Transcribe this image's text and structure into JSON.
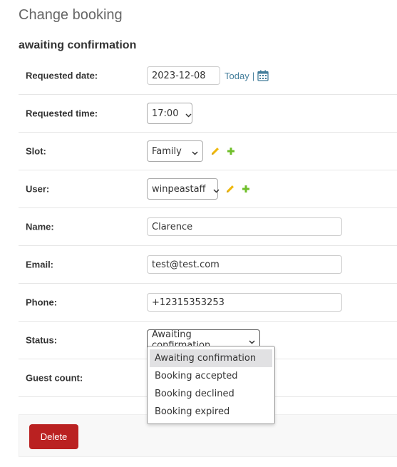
{
  "header": {
    "title": "Change booking",
    "section": "awaiting confirmation"
  },
  "form": {
    "requested_date": {
      "label": "Requested date:",
      "value": "2023-12-08",
      "today_link": "Today",
      "separator": "|"
    },
    "requested_time": {
      "label": "Requested time:",
      "value": "17:00"
    },
    "slot": {
      "label": "Slot:",
      "value": "Family"
    },
    "user": {
      "label": "User:",
      "value": "winpeastaff"
    },
    "name": {
      "label": "Name:",
      "value": "Clarence"
    },
    "email": {
      "label": "Email:",
      "value": "test@test.com"
    },
    "phone": {
      "label": "Phone:",
      "value": "+12315353253"
    },
    "status": {
      "label": "Status:",
      "value": "Awaiting confirmation",
      "options": [
        "Awaiting confirmation",
        "Booking accepted",
        "Booking declined",
        "Booking expired"
      ],
      "highlighted_index": 0
    },
    "guest_count": {
      "label": "Guest count:"
    }
  },
  "actions": {
    "delete_label": "Delete"
  },
  "colors": {
    "link": "#447e9b",
    "delete": "#ba2121",
    "edit_icon": "#efb80b",
    "add_icon": "#70bf2b"
  },
  "icons": {
    "calendar": "calendar-icon",
    "edit": "pencil-icon",
    "add": "plus-icon",
    "chevron": "chevron-down-icon"
  }
}
